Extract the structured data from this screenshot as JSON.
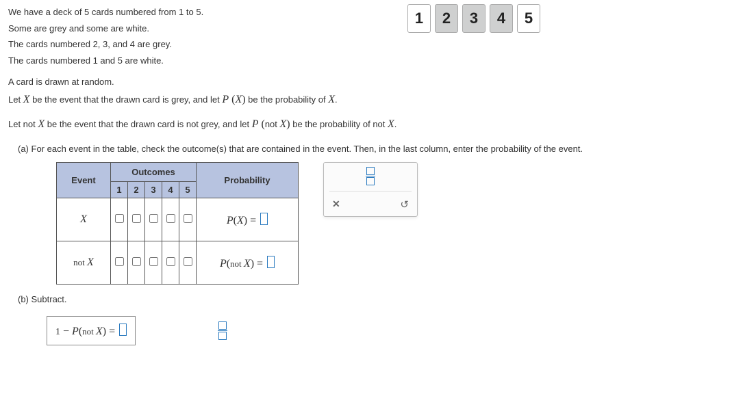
{
  "intro": {
    "l1": "We have a deck of 5 cards numbered from 1 to 5.",
    "l2": "Some are grey and some are white.",
    "l3": "The cards numbered 2, 3, and 4 are grey.",
    "l4": "The cards numbered 1 and 5 are white."
  },
  "cards": [
    {
      "n": "1",
      "shade": "white"
    },
    {
      "n": "2",
      "shade": "grey"
    },
    {
      "n": "3",
      "shade": "grey"
    },
    {
      "n": "4",
      "shade": "grey"
    },
    {
      "n": "5",
      "shade": "white"
    }
  ],
  "p1": {
    "l1": "A card is drawn at random.",
    "l2_a": "Let ",
    "l2_x": "X",
    "l2_b": " be the event that the drawn card is grey, and let ",
    "l2_P": "P",
    "l2_open": " (",
    "l2_close": ")",
    "l2_c": " be the probability of ",
    "l2_d": "."
  },
  "p2": {
    "a": "Let not ",
    "x": "X",
    "b": " be the event that the drawn card is not grey, and let ",
    "P": "P",
    "open": " (",
    "not": "not ",
    "close": ")",
    "c": " be the probability of not ",
    "d": "."
  },
  "part_a": "(a)  For each event in the table, check the outcome(s) that are contained in the event. Then, in the last column, enter the probability of the event.",
  "table": {
    "h_event": "Event",
    "h_outcomes": "Outcomes",
    "h_prob": "Probability",
    "cols": [
      "1",
      "2",
      "3",
      "4",
      "5"
    ],
    "r1_event": "X",
    "r1_prob_P": "P",
    "r1_prob_open": "(",
    "r1_prob_x": "X",
    "r1_prob_close": ")",
    "r1_prob_eq": " = ",
    "r2_event_pre": "not ",
    "r2_event_x": "X",
    "r2_prob_P": "P",
    "r2_prob_open": "(",
    "r2_prob_not": "not ",
    "r2_prob_x": "X",
    "r2_prob_close": ")",
    "r2_prob_eq": " = "
  },
  "palette": {
    "clear": "✕",
    "reset": "↺"
  },
  "part_b": "(b)  Subtract.",
  "subtract": {
    "one": "1",
    "minus": " − ",
    "P": "P",
    "open": "(",
    "not": "not ",
    "x": "X",
    "close": ")",
    "eq": " = "
  }
}
